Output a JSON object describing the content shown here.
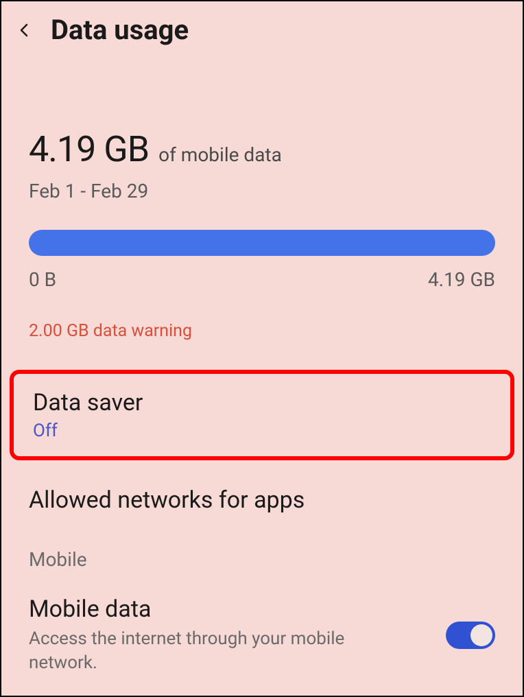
{
  "header": {
    "title": "Data usage"
  },
  "usage": {
    "amount": "4.19 GB",
    "label": "of mobile data",
    "date_range": "Feb 1 - Feb 29",
    "progress_min": "0 B",
    "progress_max": "4.19 GB",
    "warning": "2.00 GB data warning"
  },
  "data_saver": {
    "title": "Data saver",
    "status": "Off"
  },
  "allowed_networks": {
    "title": "Allowed networks for apps"
  },
  "section": {
    "mobile_label": "Mobile"
  },
  "mobile_data": {
    "title": "Mobile data",
    "description": "Access the internet through your mobile network.",
    "enabled": true
  }
}
